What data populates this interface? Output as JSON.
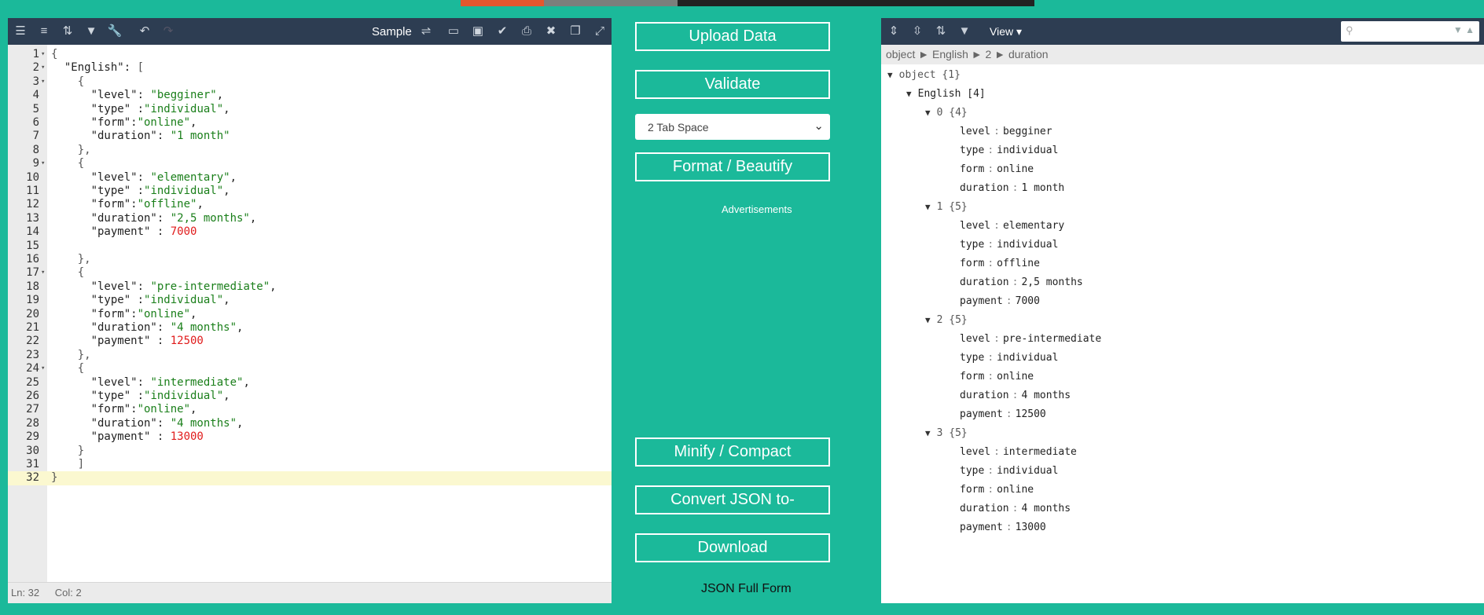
{
  "editor": {
    "sample_label": "Sample",
    "status_ln": "Ln: 32",
    "status_col": "Col: 2",
    "lines": [
      {
        "n": "1",
        "fold": true,
        "tok": [
          [
            "p",
            "{"
          ]
        ]
      },
      {
        "n": "2",
        "fold": true,
        "tok": [
          [
            "t",
            "  \"English\": "
          ],
          [
            "p",
            "["
          ]
        ]
      },
      {
        "n": "3",
        "fold": true,
        "tok": [
          [
            "p",
            "    {"
          ]
        ]
      },
      {
        "n": "4",
        "tok": [
          [
            "t",
            "      \"level\": "
          ],
          [
            "s",
            "\"begginer\""
          ],
          [
            "t",
            ","
          ]
        ]
      },
      {
        "n": "5",
        "tok": [
          [
            "t",
            "      \"type\" :"
          ],
          [
            "s",
            "\"individual\""
          ],
          [
            "t",
            ","
          ]
        ]
      },
      {
        "n": "6",
        "tok": [
          [
            "t",
            "      \"form\":"
          ],
          [
            "s",
            "\"online\""
          ],
          [
            "t",
            ","
          ]
        ]
      },
      {
        "n": "7",
        "tok": [
          [
            "t",
            "      \"duration\": "
          ],
          [
            "s",
            "\"1 month\""
          ]
        ]
      },
      {
        "n": "8",
        "tok": [
          [
            "p",
            "    },"
          ]
        ]
      },
      {
        "n": "9",
        "fold": true,
        "tok": [
          [
            "p",
            "    {"
          ]
        ]
      },
      {
        "n": "10",
        "tok": [
          [
            "t",
            "      \"level\": "
          ],
          [
            "s",
            "\"elementary\""
          ],
          [
            "t",
            ","
          ]
        ]
      },
      {
        "n": "11",
        "tok": [
          [
            "t",
            "      \"type\" :"
          ],
          [
            "s",
            "\"individual\""
          ],
          [
            "t",
            ","
          ]
        ]
      },
      {
        "n": "12",
        "tok": [
          [
            "t",
            "      \"form\":"
          ],
          [
            "s",
            "\"offline\""
          ],
          [
            "t",
            ","
          ]
        ]
      },
      {
        "n": "13",
        "tok": [
          [
            "t",
            "      \"duration\": "
          ],
          [
            "s",
            "\"2,5 months\""
          ],
          [
            "t",
            ","
          ]
        ]
      },
      {
        "n": "14",
        "tok": [
          [
            "t",
            "      \"payment\" : "
          ],
          [
            "n",
            "7000"
          ]
        ]
      },
      {
        "n": "15",
        "tok": []
      },
      {
        "n": "16",
        "tok": [
          [
            "p",
            "    },"
          ]
        ]
      },
      {
        "n": "17",
        "fold": true,
        "tok": [
          [
            "p",
            "    {"
          ]
        ]
      },
      {
        "n": "18",
        "tok": [
          [
            "t",
            "      \"level\": "
          ],
          [
            "s",
            "\"pre-intermediate\""
          ],
          [
            "t",
            ","
          ]
        ]
      },
      {
        "n": "19",
        "tok": [
          [
            "t",
            "      \"type\" :"
          ],
          [
            "s",
            "\"individual\""
          ],
          [
            "t",
            ","
          ]
        ]
      },
      {
        "n": "20",
        "tok": [
          [
            "t",
            "      \"form\":"
          ],
          [
            "s",
            "\"online\""
          ],
          [
            "t",
            ","
          ]
        ]
      },
      {
        "n": "21",
        "tok": [
          [
            "t",
            "      \"duration\": "
          ],
          [
            "s",
            "\"4 months\""
          ],
          [
            "t",
            ","
          ]
        ]
      },
      {
        "n": "22",
        "tok": [
          [
            "t",
            "      \"payment\" : "
          ],
          [
            "n",
            "12500"
          ]
        ]
      },
      {
        "n": "23",
        "tok": [
          [
            "p",
            "    },"
          ]
        ]
      },
      {
        "n": "24",
        "fold": true,
        "tok": [
          [
            "p",
            "    {"
          ]
        ]
      },
      {
        "n": "25",
        "tok": [
          [
            "t",
            "      \"level\": "
          ],
          [
            "s",
            "\"intermediate\""
          ],
          [
            "t",
            ","
          ]
        ]
      },
      {
        "n": "26",
        "tok": [
          [
            "t",
            "      \"type\" :"
          ],
          [
            "s",
            "\"individual\""
          ],
          [
            "t",
            ","
          ]
        ]
      },
      {
        "n": "27",
        "tok": [
          [
            "t",
            "      \"form\":"
          ],
          [
            "s",
            "\"online\""
          ],
          [
            "t",
            ","
          ]
        ]
      },
      {
        "n": "28",
        "tok": [
          [
            "t",
            "      \"duration\": "
          ],
          [
            "s",
            "\"4 months\""
          ],
          [
            "t",
            ","
          ]
        ]
      },
      {
        "n": "29",
        "tok": [
          [
            "t",
            "      \"payment\" : "
          ],
          [
            "n",
            "13000"
          ]
        ]
      },
      {
        "n": "30",
        "tok": [
          [
            "p",
            "    }"
          ]
        ]
      },
      {
        "n": "31",
        "tok": [
          [
            "p",
            "    ]"
          ]
        ]
      },
      {
        "n": "32",
        "active": true,
        "tok": [
          [
            "p",
            "}"
          ]
        ]
      }
    ]
  },
  "controls": {
    "upload": "Upload Data",
    "validate": "Validate",
    "indent_selected": "2 Tab Space",
    "format": "Format / Beautify",
    "ads": "Advertisements",
    "minify": "Minify / Compact",
    "convert": "Convert JSON to-",
    "download": "Download",
    "full_form": "JSON Full Form"
  },
  "viewer": {
    "view_label": "View ▾",
    "breadcrumb": "object ► English ► 2 ► duration",
    "root": "object {1}",
    "array": "English [4]",
    "items": [
      {
        "header": "0 {4}",
        "fields": [
          [
            "level",
            "begginer"
          ],
          [
            "type",
            "individual"
          ],
          [
            "form",
            "online"
          ],
          [
            "duration",
            "1 month"
          ]
        ]
      },
      {
        "header": "1 {5}",
        "fields": [
          [
            "level",
            "elementary"
          ],
          [
            "type",
            "individual"
          ],
          [
            "form",
            "offline"
          ],
          [
            "duration",
            "2,5 months"
          ],
          [
            "payment",
            "7000"
          ]
        ]
      },
      {
        "header": "2 {5}",
        "fields": [
          [
            "level",
            "pre-intermediate"
          ],
          [
            "type",
            "individual"
          ],
          [
            "form",
            "online"
          ],
          [
            "duration",
            "4 months"
          ],
          [
            "payment",
            "12500"
          ]
        ]
      },
      {
        "header": "3 {5}",
        "fields": [
          [
            "level",
            "intermediate"
          ],
          [
            "type",
            "individual"
          ],
          [
            "form",
            "online"
          ],
          [
            "duration",
            "4 months"
          ],
          [
            "payment",
            "13000"
          ]
        ]
      }
    ]
  }
}
